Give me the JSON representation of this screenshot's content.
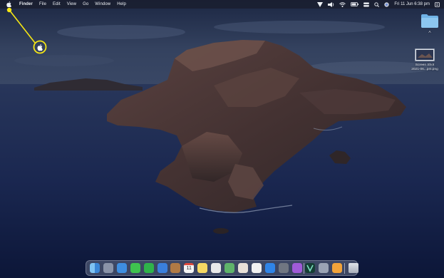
{
  "menubar": {
    "apple_menu": "apple-logo",
    "app_name": "Finder",
    "menus": [
      "File",
      "Edit",
      "View",
      "Go",
      "Window",
      "Help"
    ],
    "clock": "Fri 11 Jun  6:38 pm",
    "status_icons": [
      "vpn-icon",
      "audio-icon",
      "wifi-icon",
      "battery-icon",
      "control-icon",
      "search-icon",
      "siri-icon",
      "notification-icon"
    ]
  },
  "desktop": {
    "folder": {
      "icon": "folder-icon",
      "label": "A"
    },
    "screenshot": {
      "icon": "screenshot-thumbnail",
      "label_line1": "Screen Shot",
      "label_line2": "2021-06...pm.png"
    }
  },
  "callout": {
    "color": "#f5e614",
    "target": "apple-menu"
  },
  "dock": {
    "apps": [
      {
        "name": "Finder",
        "icon": "finder-icon",
        "color": "#4a8fd8"
      },
      {
        "name": "Launchpad",
        "icon": "launchpad-icon",
        "color": "#8a93a8"
      },
      {
        "name": "Mail",
        "icon": "mail-icon",
        "color": "#3e8ee0"
      },
      {
        "name": "Messages",
        "icon": "messages-icon",
        "color": "#3fc24f"
      },
      {
        "name": "FaceTime",
        "icon": "facetime-icon",
        "color": "#2fb34a"
      },
      {
        "name": "Safari",
        "icon": "safari-icon",
        "color": "#3a7fdc"
      },
      {
        "name": "Photos",
        "icon": "photos-icon",
        "color": "#b07a45"
      },
      {
        "name": "Calendar",
        "icon": "calendar-icon",
        "color": "#f2f2f2",
        "label": "11"
      },
      {
        "name": "Notes",
        "icon": "notes-icon",
        "color": "#f5d863"
      },
      {
        "name": "Reminders",
        "icon": "reminders-icon",
        "color": "#e9e9e9"
      },
      {
        "name": "Maps",
        "icon": "maps-icon",
        "color": "#5fb36a"
      },
      {
        "name": "Photos Library",
        "icon": "photos-flower-icon",
        "color": "#e8e0d8"
      },
      {
        "name": "Music",
        "icon": "music-icon",
        "color": "#f1f1f1"
      },
      {
        "name": "App Store",
        "icon": "appstore-icon",
        "color": "#2f84e8"
      },
      {
        "name": "System Preferences",
        "icon": "settings-icon",
        "color": "#707682"
      },
      {
        "name": "Podcasts",
        "icon": "podcasts-icon",
        "color": "#a05bd8"
      },
      {
        "name": "Vectorize",
        "icon": "vector-icon",
        "color": "#153e35"
      },
      {
        "name": "Preview",
        "icon": "preview-icon",
        "color": "#9aa3b4"
      },
      {
        "name": "Pages",
        "icon": "pages-icon",
        "color": "#f2a33a"
      },
      {
        "name": "Trash",
        "icon": "trash-icon",
        "color": "#b9bec8"
      }
    ]
  }
}
